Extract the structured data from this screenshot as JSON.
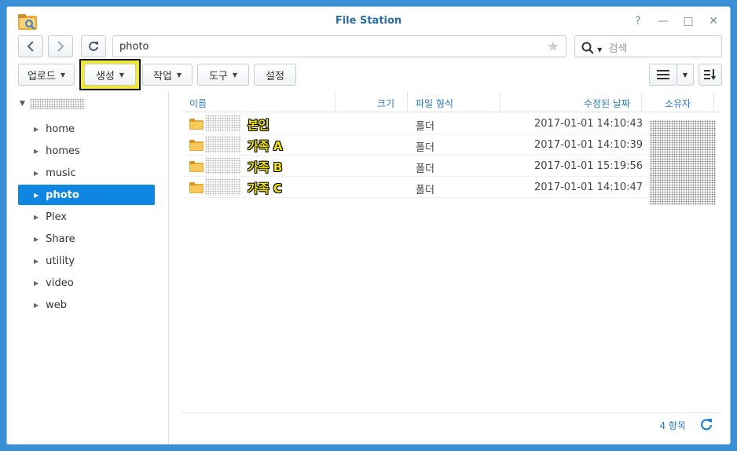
{
  "window": {
    "title": "File Station",
    "controls": [
      "?",
      "—",
      "□",
      "✕"
    ]
  },
  "nav": {
    "path": "photo",
    "search_placeholder": "검색"
  },
  "toolbar": {
    "upload": "업로드",
    "create": "생성",
    "action": "작업",
    "tools": "도구",
    "settings": "설정"
  },
  "sidebar": {
    "items": [
      {
        "label": "home"
      },
      {
        "label": "homes"
      },
      {
        "label": "music"
      },
      {
        "label": "photo",
        "selected": true
      },
      {
        "label": "Plex"
      },
      {
        "label": "Share"
      },
      {
        "label": "utility"
      },
      {
        "label": "video"
      },
      {
        "label": "web"
      }
    ]
  },
  "table": {
    "columns": {
      "name": "이름",
      "size": "크기",
      "type": "파일 형식",
      "modified": "수정된 날짜",
      "owner": "소유자"
    },
    "rows": [
      {
        "name": "본인",
        "type": "폴더",
        "modified": "2017-01-01 14:10:43"
      },
      {
        "name": "가족 A",
        "type": "폴더",
        "modified": "2017-01-01 14:10:39"
      },
      {
        "name": "가족 B",
        "type": "폴더",
        "modified": "2017-01-01 15:19:56"
      },
      {
        "name": "가족 C",
        "type": "폴더",
        "modified": "2017-01-01 14:10:47"
      }
    ]
  },
  "status": {
    "count": "4 항목"
  },
  "colors": {
    "accent": "#0f86e0",
    "header_text": "#2b7ac0",
    "highlight": "#f5e82a",
    "folder": "#f2c14e"
  },
  "icons": [
    "folder-icon",
    "back-icon",
    "forward-icon",
    "refresh-icon",
    "star-icon",
    "search-icon",
    "list-view-icon",
    "sort-icon"
  ]
}
